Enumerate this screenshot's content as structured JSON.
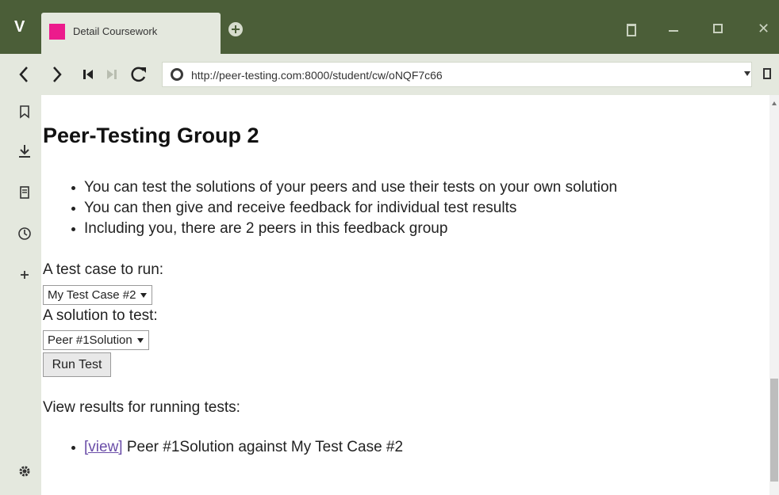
{
  "browser": {
    "tab_title": "Detail Coursework",
    "url": "http://peer-testing.com:8000/student/cw/oNQF7c66",
    "favicon_color": "#ec1b8c",
    "chrome_color": "#4b5e38",
    "toolbar_color": "#e4e8de"
  },
  "page": {
    "title": "Peer-Testing Group 2",
    "info": [
      "You can test the solutions of your peers and use their tests on your own solution",
      "You can then give and receive feedback for individual test results",
      "Including you, there are 2 peers in this feedback group"
    ],
    "test_case_label": "A test case to run:",
    "test_case_selected": "My Test Case #2",
    "solution_label": "A solution to test:",
    "solution_selected": "Peer #1Solution",
    "run_button": "Run Test",
    "results_label": "View results for running tests:",
    "results": [
      {
        "link": "[view]",
        "text": " Peer #1Solution against My Test Case #2"
      }
    ]
  }
}
